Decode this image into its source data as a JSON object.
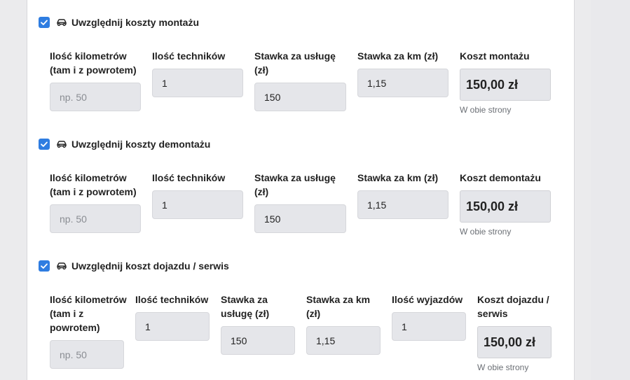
{
  "sections": [
    {
      "checkbox_checked": true,
      "title": "Uwzględnij koszty montażu",
      "labels": {
        "km": "Ilość kilometrów (tam i z powrotem)",
        "techs": "Ilość techników",
        "rate": "Stawka za usługę (zł)",
        "km_rate": "Stawka za km (zł)",
        "cost": "Koszt montażu"
      },
      "km_placeholder": "np. 50",
      "km_value": "",
      "techs_value": "1",
      "rate_value": "150",
      "km_rate_value": "1,15",
      "cost_value": "150,00 zł",
      "cost_help": "W obie strony"
    },
    {
      "checkbox_checked": true,
      "title": "Uwzględnij koszty demontażu",
      "labels": {
        "km": "Ilość kilometrów (tam i z powrotem)",
        "techs": "Ilość techników",
        "rate": "Stawka za usługę (zł)",
        "km_rate": "Stawka za km (zł)",
        "cost": "Koszt demontażu"
      },
      "km_placeholder": "np. 50",
      "km_value": "",
      "techs_value": "1",
      "rate_value": "150",
      "km_rate_value": "1,15",
      "cost_value": "150,00 zł",
      "cost_help": "W obie strony"
    },
    {
      "checkbox_checked": true,
      "title": "Uwzględnij koszt dojazdu / serwis",
      "labels": {
        "km": "Ilość kilometrów (tam i z powrotem)",
        "techs": "Ilość techników",
        "rate": "Stawka za usługę (zł)",
        "km_rate": "Stawka za km (zł)",
        "trips": "Ilość wyjazdów",
        "cost": "Koszt dojazdu / serwis"
      },
      "km_placeholder": "np. 50",
      "km_value": "",
      "techs_value": "1",
      "rate_value": "150",
      "km_rate_value": "1,15",
      "trips_value": "1",
      "cost_value": "150,00 zł",
      "cost_help": "W obie strony"
    }
  ],
  "colors": {
    "checkbox": "#2f7de1",
    "input_bg": "#e5e6ea",
    "page_bg": "#ebebed"
  },
  "icons": {
    "checkbox": "check-icon",
    "section": "car-icon"
  }
}
